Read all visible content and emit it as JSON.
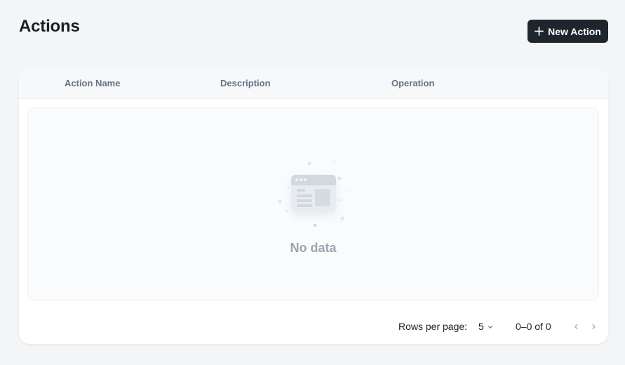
{
  "header": {
    "title": "Actions",
    "new_action_label": "New Action"
  },
  "table": {
    "columns": [
      "Action Name",
      "Description",
      "Operation"
    ],
    "rows": [],
    "empty_text": "No data"
  },
  "pagination": {
    "rows_per_page_label": "Rows per page:",
    "rows_per_page_value": "5",
    "range_text": "0–0 of 0"
  },
  "icons": {
    "new_action": "plus-icon",
    "rows_select": "chevron-down-icon",
    "prev": "chevron-left-icon",
    "next": "chevron-right-icon",
    "empty": "empty-browser-illustration-icon"
  },
  "colors": {
    "background": "#f4f5f7",
    "primary_button": "#1e252c",
    "header_text": "#667383",
    "empty_text": "#9ba4af"
  }
}
